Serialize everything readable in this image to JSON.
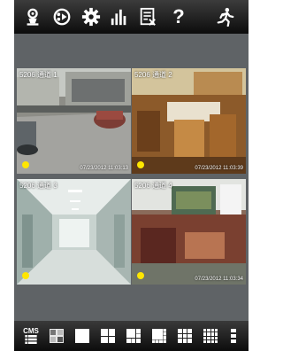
{
  "toolbar": {
    "icons": [
      "ptz-control-icon",
      "media-playback-icon",
      "settings-gear-icon",
      "signal-bars-icon",
      "document-list-icon",
      "help-icon",
      "exit-running-icon"
    ],
    "help_symbol": "?"
  },
  "channels": [
    {
      "label": "5206 通道 1",
      "time": "07/23/2012 11:03:13",
      "recording": true,
      "selected": true
    },
    {
      "label": "5206 通道 2",
      "time": "07/23/2012 11:03:39",
      "recording": true,
      "selected": false
    },
    {
      "label": "5206 通道 3",
      "time": "",
      "recording": true,
      "selected": false
    },
    {
      "label": "5206 通道 4",
      "time": "07/23/2012 11:03:34",
      "recording": true,
      "selected": false
    }
  ],
  "bottombar": {
    "cms_label": "CMS",
    "layouts": [
      "cms-icon",
      "split-view-icon",
      "single-view-icon",
      "quad-view-icon",
      "six-view-icon",
      "eight-view-icon",
      "nine-view-icon",
      "sixteen-view-icon",
      "more-view-icon"
    ]
  }
}
